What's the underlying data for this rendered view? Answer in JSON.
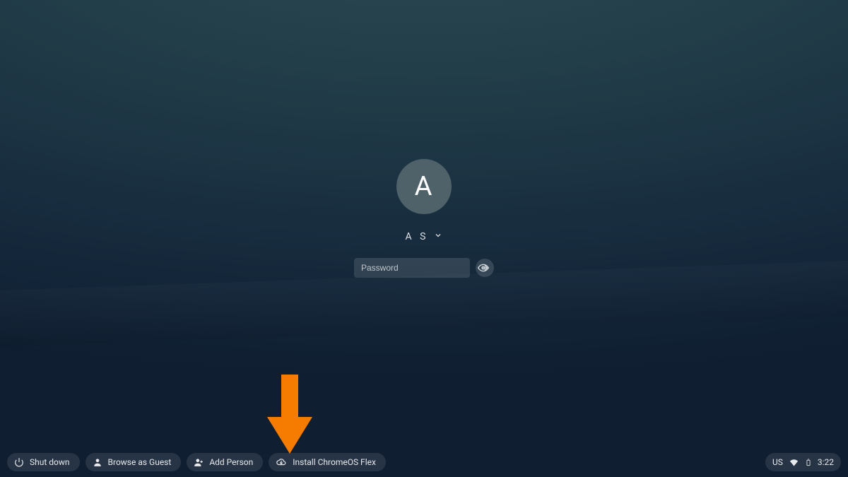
{
  "user": {
    "avatar_initial": "A",
    "display_name": "A S"
  },
  "password": {
    "placeholder": "Password"
  },
  "shelf": {
    "shutdown": "Shut down",
    "guest": "Browse as Guest",
    "add_person": "Add Person",
    "install": "Install ChromeOS Flex"
  },
  "tray": {
    "keyboard": "US",
    "clock": "3:22"
  }
}
